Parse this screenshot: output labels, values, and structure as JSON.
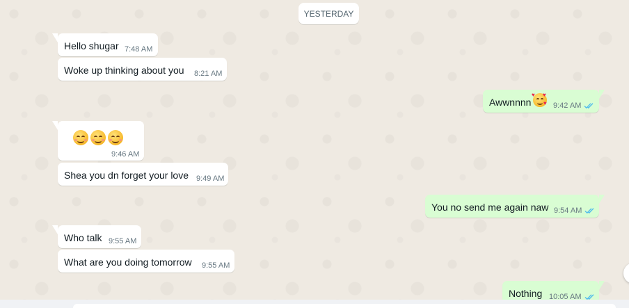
{
  "chat": {
    "date_label": "YESTERDAY",
    "messages": [
      {
        "dir": "in",
        "text": "Hello shugar",
        "time": "7:48 AM"
      },
      {
        "dir": "in",
        "text": "Woke up thinking about you",
        "time": "8:21 AM"
      },
      {
        "dir": "out",
        "text": "Awwnnnn",
        "emoji": "smiling-face-with-hearts-emoji",
        "time": "9:42 AM",
        "status": "read-double-tick-icon"
      },
      {
        "dir": "in",
        "text": "",
        "emoji": "smiling-face-emoji x3",
        "time": "9:46 AM"
      },
      {
        "dir": "in",
        "text": "Shea you dn forget your love",
        "time": "9:49 AM"
      },
      {
        "dir": "out",
        "text": "You no send me again naw",
        "time": "9:54 AM",
        "status": "read-double-tick-icon"
      },
      {
        "dir": "in",
        "text": "Who talk",
        "time": "9:55 AM"
      },
      {
        "dir": "in",
        "text": "What are you doing tomorrow",
        "time": "9:55 AM"
      },
      {
        "dir": "out",
        "text": "Nothing",
        "time": "10:05 AM",
        "status": "read-double-tick-icon"
      }
    ]
  },
  "colors": {
    "chat_background": "#efeae2",
    "incoming_bubble": "#ffffff",
    "outgoing_bubble": "#d9fdd3",
    "read_tick": "#53bdeb",
    "timestamp": "#667781"
  }
}
